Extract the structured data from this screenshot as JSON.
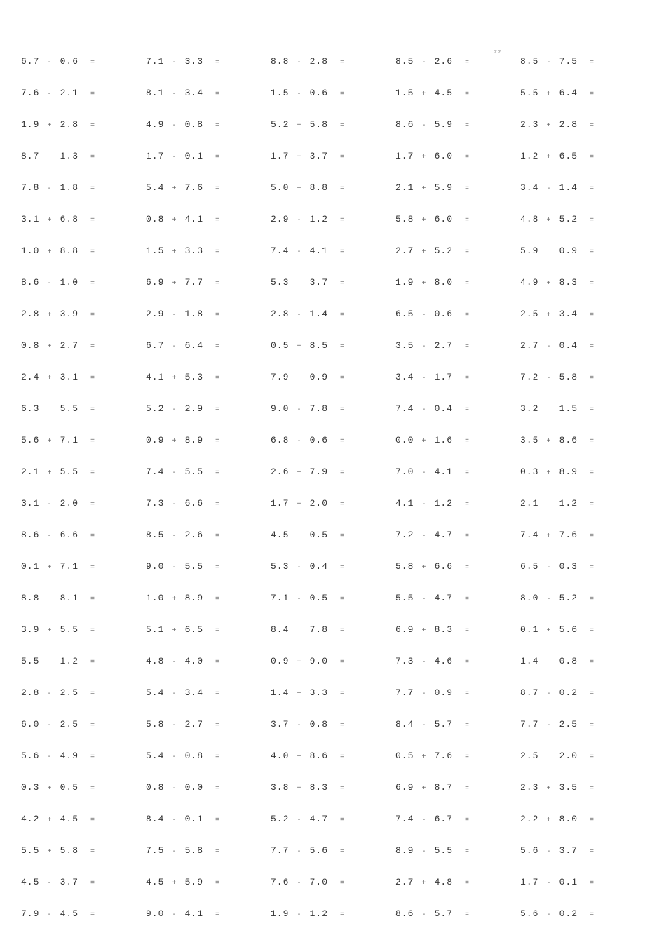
{
  "annotation_zz": "zz",
  "problems": [
    {
      "a": "6.7",
      "op": "-",
      "b": "0.6",
      "eq": "="
    },
    {
      "a": "7.1",
      "op": "-",
      "b": "3.3",
      "eq": "="
    },
    {
      "a": "8.8",
      "op": "-",
      "b": "2.8",
      "eq": "="
    },
    {
      "a": "8.5",
      "op": "-",
      "b": "2.6",
      "eq": "=",
      "zz": true
    },
    {
      "a": "8.5",
      "op": "-",
      "b": "7.5",
      "eq": "="
    },
    {
      "a": "7.6",
      "op": "-",
      "b": "2.1",
      "eq": "="
    },
    {
      "a": "8.1",
      "op": "-",
      "b": "3.4",
      "eq": "="
    },
    {
      "a": "1.5",
      "op": "-",
      "b": "0.6",
      "eq": "="
    },
    {
      "a": "1.5",
      "op": "+",
      "b": "4.5",
      "eq": "="
    },
    {
      "a": "5.5",
      "op": "+",
      "b": "6.4",
      "eq": "="
    },
    {
      "a": "1.9",
      "op": "+",
      "b": "2.8",
      "eq": "="
    },
    {
      "a": "4.9",
      "op": "-",
      "b": "0.8",
      "eq": "="
    },
    {
      "a": "5.2",
      "op": "+",
      "b": "5.8",
      "eq": "="
    },
    {
      "a": "8.6",
      "op": "-",
      "b": "5.9",
      "eq": "="
    },
    {
      "a": "2.3",
      "op": "+",
      "b": "2.8",
      "eq": "="
    },
    {
      "a": "8.7",
      "op": "",
      "b": "1.3",
      "eq": "="
    },
    {
      "a": "1.7",
      "op": "-",
      "b": "0.1",
      "eq": "="
    },
    {
      "a": "1.7",
      "op": "+",
      "b": "3.7",
      "eq": "="
    },
    {
      "a": "1.7",
      "op": "+",
      "b": "6.0",
      "eq": "="
    },
    {
      "a": "1.2",
      "op": "+",
      "b": "6.5",
      "eq": "="
    },
    {
      "a": "7.8",
      "op": "-",
      "b": "1.8",
      "eq": "="
    },
    {
      "a": "5.4",
      "op": "+",
      "b": "7.6",
      "eq": "="
    },
    {
      "a": "5.0",
      "op": "+",
      "b": "8.8",
      "eq": "="
    },
    {
      "a": "2.1",
      "op": "+",
      "b": "5.9",
      "eq": "="
    },
    {
      "a": "3.4",
      "op": "-",
      "b": "1.4",
      "eq": "="
    },
    {
      "a": "3.1",
      "op": "+",
      "b": "6.8",
      "eq": "="
    },
    {
      "a": "0.8",
      "op": "+",
      "b": "4.1",
      "eq": "="
    },
    {
      "a": "2.9",
      "op": "-",
      "b": "1.2",
      "eq": "="
    },
    {
      "a": "5.8",
      "op": "+",
      "b": "6.0",
      "eq": "="
    },
    {
      "a": "4.8",
      "op": "+",
      "b": "5.2",
      "eq": "="
    },
    {
      "a": "1.0",
      "op": "+",
      "b": "8.8",
      "eq": "="
    },
    {
      "a": "1.5",
      "op": "+",
      "b": "3.3",
      "eq": "="
    },
    {
      "a": "7.4",
      "op": "-",
      "b": "4.1",
      "eq": "="
    },
    {
      "a": "2.7",
      "op": "+",
      "b": "5.2",
      "eq": "="
    },
    {
      "a": "5.9",
      "op": "",
      "b": "0.9",
      "eq": "="
    },
    {
      "a": "8.6",
      "op": "-",
      "b": "1.0",
      "eq": "="
    },
    {
      "a": "6.9",
      "op": "+",
      "b": "7.7",
      "eq": "="
    },
    {
      "a": "5.3",
      "op": "",
      "b": "3.7",
      "eq": "="
    },
    {
      "a": "1.9",
      "op": "+",
      "b": "8.0",
      "eq": "="
    },
    {
      "a": "4.9",
      "op": "+",
      "b": "8.3",
      "eq": "="
    },
    {
      "a": "2.8",
      "op": "+",
      "b": "3.9",
      "eq": "="
    },
    {
      "a": "2.9",
      "op": "-",
      "b": "1.8",
      "eq": "="
    },
    {
      "a": "2.8",
      "op": "-",
      "b": "1.4",
      "eq": "="
    },
    {
      "a": "6.5",
      "op": "-",
      "b": "0.6",
      "eq": "="
    },
    {
      "a": "2.5",
      "op": "+",
      "b": "3.4",
      "eq": "="
    },
    {
      "a": "0.8",
      "op": "+",
      "b": "2.7",
      "eq": "="
    },
    {
      "a": "6.7",
      "op": "-",
      "b": "6.4",
      "eq": "="
    },
    {
      "a": "0.5",
      "op": "+",
      "b": "8.5",
      "eq": "="
    },
    {
      "a": "3.5",
      "op": "-",
      "b": "2.7",
      "eq": "="
    },
    {
      "a": "2.7",
      "op": "-",
      "b": "0.4",
      "eq": "="
    },
    {
      "a": "2.4",
      "op": "+",
      "b": "3.1",
      "eq": "="
    },
    {
      "a": "4.1",
      "op": "+",
      "b": "5.3",
      "eq": "="
    },
    {
      "a": "7.9",
      "op": "",
      "b": "0.9",
      "eq": "="
    },
    {
      "a": "3.4",
      "op": "-",
      "b": "1.7",
      "eq": "="
    },
    {
      "a": "7.2",
      "op": "-",
      "b": "5.8",
      "eq": "="
    },
    {
      "a": "6.3",
      "op": "",
      "b": "5.5",
      "eq": "="
    },
    {
      "a": "5.2",
      "op": "-",
      "b": "2.9",
      "eq": "="
    },
    {
      "a": "9.0",
      "op": "-",
      "b": "7.8",
      "eq": "="
    },
    {
      "a": "7.4",
      "op": "-",
      "b": "0.4",
      "eq": "="
    },
    {
      "a": "3.2",
      "op": "",
      "b": "1.5",
      "eq": "="
    },
    {
      "a": "5.6",
      "op": "+",
      "b": "7.1",
      "eq": "="
    },
    {
      "a": "0.9",
      "op": "+",
      "b": "8.9",
      "eq": "="
    },
    {
      "a": "6.8",
      "op": "-",
      "b": "0.6",
      "eq": "="
    },
    {
      "a": "0.0",
      "op": "+",
      "b": "1.6",
      "eq": "="
    },
    {
      "a": "3.5",
      "op": "+",
      "b": "8.6",
      "eq": "="
    },
    {
      "a": "2.1",
      "op": "+",
      "b": "5.5",
      "eq": "="
    },
    {
      "a": "7.4",
      "op": "-",
      "b": "5.5",
      "eq": "="
    },
    {
      "a": "2.6",
      "op": "+",
      "b": "7.9",
      "eq": "="
    },
    {
      "a": "7.0",
      "op": "-",
      "b": "4.1",
      "eq": "="
    },
    {
      "a": "0.3",
      "op": "+",
      "b": "8.9",
      "eq": "="
    },
    {
      "a": "3.1",
      "op": "-",
      "b": "2.0",
      "eq": "="
    },
    {
      "a": "7.3",
      "op": "-",
      "b": "6.6",
      "eq": "="
    },
    {
      "a": "1.7",
      "op": "+",
      "b": "2.0",
      "eq": "="
    },
    {
      "a": "4.1",
      "op": "-",
      "b": "1.2",
      "eq": "="
    },
    {
      "a": "2.1",
      "op": "",
      "b": "1.2",
      "eq": "="
    },
    {
      "a": "8.6",
      "op": "-",
      "b": "6.6",
      "eq": "="
    },
    {
      "a": "8.5",
      "op": "-",
      "b": "2.6",
      "eq": "="
    },
    {
      "a": "4.5",
      "op": "",
      "b": "0.5",
      "eq": "="
    },
    {
      "a": "7.2",
      "op": "-",
      "b": "4.7",
      "eq": "="
    },
    {
      "a": "7.4",
      "op": "+",
      "b": "7.6",
      "eq": "="
    },
    {
      "a": "0.1",
      "op": "+",
      "b": "7.1",
      "eq": "="
    },
    {
      "a": "9.0",
      "op": "-",
      "b": "5.5",
      "eq": "="
    },
    {
      "a": "5.3",
      "op": "-",
      "b": "0.4",
      "eq": "="
    },
    {
      "a": "5.8",
      "op": "+",
      "b": "6.6",
      "eq": "="
    },
    {
      "a": "6.5",
      "op": "-",
      "b": "0.3",
      "eq": "="
    },
    {
      "a": "8.8",
      "op": "",
      "b": "8.1",
      "eq": "="
    },
    {
      "a": "1.0",
      "op": "+",
      "b": "8.9",
      "eq": "="
    },
    {
      "a": "7.1",
      "op": "-",
      "b": "0.5",
      "eq": "="
    },
    {
      "a": "5.5",
      "op": "-",
      "b": "4.7",
      "eq": "="
    },
    {
      "a": "8.0",
      "op": "-",
      "b": "5.2",
      "eq": "="
    },
    {
      "a": "3.9",
      "op": "+",
      "b": "5.5",
      "eq": "="
    },
    {
      "a": "5.1",
      "op": "+",
      "b": "6.5",
      "eq": "="
    },
    {
      "a": "8.4",
      "op": "",
      "b": "7.8",
      "eq": "="
    },
    {
      "a": "6.9",
      "op": "+",
      "b": "8.3",
      "eq": "="
    },
    {
      "a": "0.1",
      "op": "+",
      "b": "5.6",
      "eq": "="
    },
    {
      "a": "5.5",
      "op": "",
      "b": "1.2",
      "eq": "="
    },
    {
      "a": "4.8",
      "op": "-",
      "b": "4.0",
      "eq": "="
    },
    {
      "a": "0.9",
      "op": "+",
      "b": "9.0",
      "eq": "="
    },
    {
      "a": "7.3",
      "op": "-",
      "b": "4.6",
      "eq": "="
    },
    {
      "a": "1.4",
      "op": "",
      "b": "0.8",
      "eq": "="
    },
    {
      "a": "2.8",
      "op": "-",
      "b": "2.5",
      "eq": "="
    },
    {
      "a": "5.4",
      "op": "-",
      "b": "3.4",
      "eq": "="
    },
    {
      "a": "1.4",
      "op": "+",
      "b": "3.3",
      "eq": "="
    },
    {
      "a": "7.7",
      "op": "-",
      "b": "0.9",
      "eq": "="
    },
    {
      "a": "8.7",
      "op": "-",
      "b": "0.2",
      "eq": "="
    },
    {
      "a": "6.0",
      "op": "-",
      "b": "2.5",
      "eq": "="
    },
    {
      "a": "5.8",
      "op": "-",
      "b": "2.7",
      "eq": "="
    },
    {
      "a": "3.7",
      "op": "-",
      "b": "0.8",
      "eq": "="
    },
    {
      "a": "8.4",
      "op": "-",
      "b": "5.7",
      "eq": "="
    },
    {
      "a": "7.7",
      "op": "-",
      "b": "2.5",
      "eq": "="
    },
    {
      "a": "5.6",
      "op": "-",
      "b": "4.9",
      "eq": "="
    },
    {
      "a": "5.4",
      "op": "-",
      "b": "0.8",
      "eq": "="
    },
    {
      "a": "4.0",
      "op": "+",
      "b": "8.6",
      "eq": "="
    },
    {
      "a": "0.5",
      "op": "+",
      "b": "7.6",
      "eq": "="
    },
    {
      "a": "2.5",
      "op": "",
      "b": "2.0",
      "eq": "="
    },
    {
      "a": "0.3",
      "op": "+",
      "b": "0.5",
      "eq": "="
    },
    {
      "a": "0.8",
      "op": "-",
      "b": "0.0",
      "eq": "="
    },
    {
      "a": "3.8",
      "op": "+",
      "b": "8.3",
      "eq": "="
    },
    {
      "a": "6.9",
      "op": "+",
      "b": "8.7",
      "eq": "="
    },
    {
      "a": "2.3",
      "op": "+",
      "b": "3.5",
      "eq": "="
    },
    {
      "a": "4.2",
      "op": "+",
      "b": "4.5",
      "eq": "="
    },
    {
      "a": "8.4",
      "op": "-",
      "b": "0.1",
      "eq": "="
    },
    {
      "a": "5.2",
      "op": "-",
      "b": "4.7",
      "eq": "="
    },
    {
      "a": "7.4",
      "op": "-",
      "b": "6.7",
      "eq": "="
    },
    {
      "a": "2.2",
      "op": "+",
      "b": "8.0",
      "eq": "="
    },
    {
      "a": "5.5",
      "op": "+",
      "b": "5.8",
      "eq": "="
    },
    {
      "a": "7.5",
      "op": "-",
      "b": "5.8",
      "eq": "="
    },
    {
      "a": "7.7",
      "op": "-",
      "b": "5.6",
      "eq": "="
    },
    {
      "a": "8.9",
      "op": "-",
      "b": "5.5",
      "eq": "="
    },
    {
      "a": "5.6",
      "op": "-",
      "b": "3.7",
      "eq": "="
    },
    {
      "a": "4.5",
      "op": "-",
      "b": "3.7",
      "eq": "="
    },
    {
      "a": "4.5",
      "op": "+",
      "b": "5.9",
      "eq": "="
    },
    {
      "a": "7.6",
      "op": "-",
      "b": "7.0",
      "eq": "="
    },
    {
      "a": "2.7",
      "op": "+",
      "b": "4.8",
      "eq": "="
    },
    {
      "a": "1.7",
      "op": "-",
      "b": "0.1",
      "eq": "="
    },
    {
      "a": "7.9",
      "op": "-",
      "b": "4.5",
      "eq": "="
    },
    {
      "a": "9.0",
      "op": "-",
      "b": "4.1",
      "eq": "="
    },
    {
      "a": "1.9",
      "op": "-",
      "b": "1.2",
      "eq": "="
    },
    {
      "a": "8.6",
      "op": "-",
      "b": "5.7",
      "eq": "="
    },
    {
      "a": "5.6",
      "op": "-",
      "b": "0.2",
      "eq": "="
    }
  ]
}
